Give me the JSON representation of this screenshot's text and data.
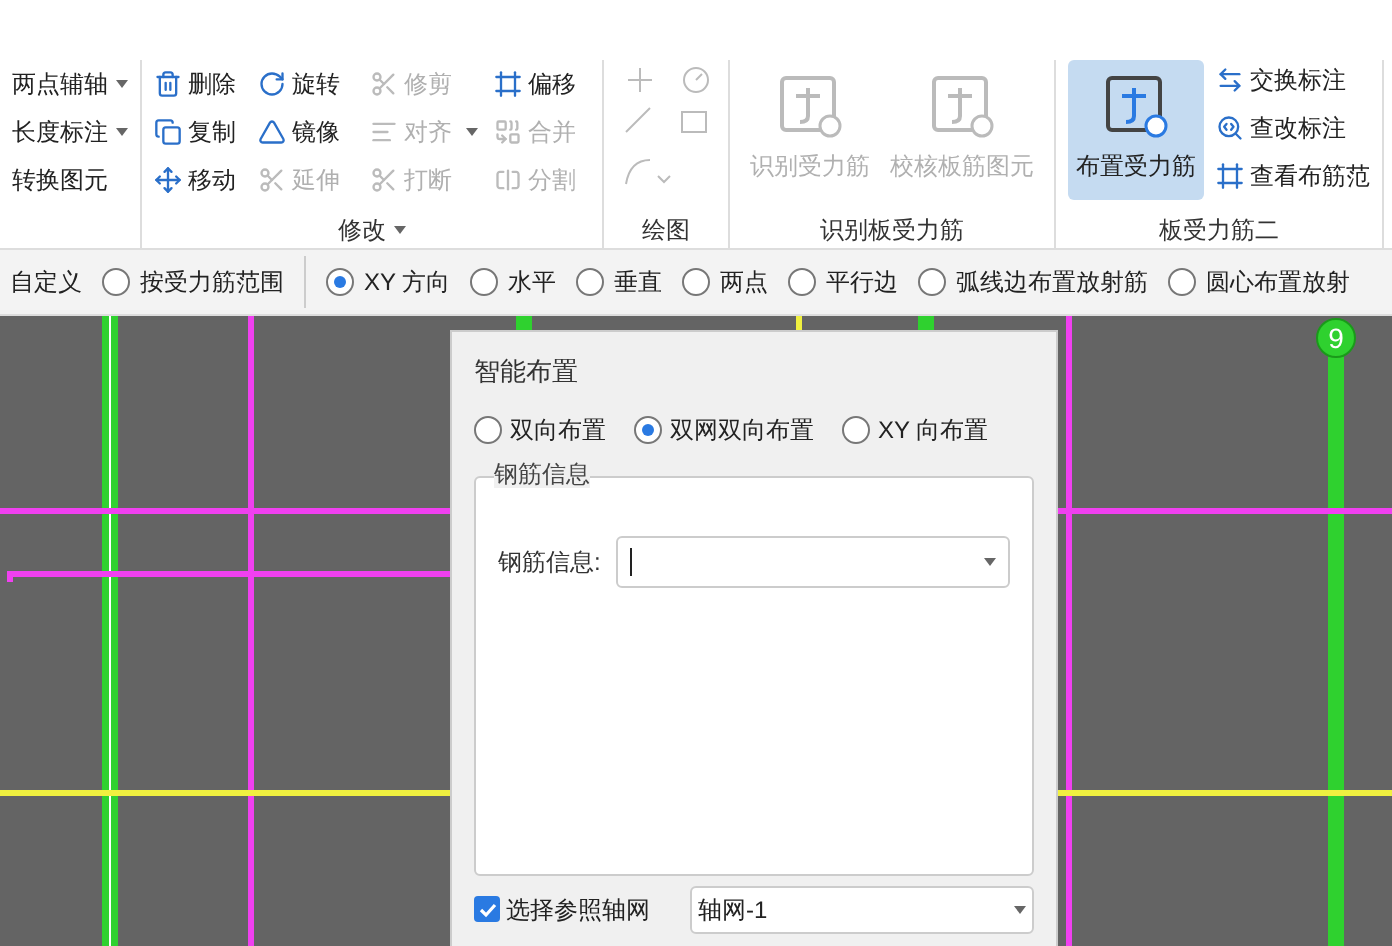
{
  "ribbon": {
    "groups": [
      {
        "kind": "list",
        "items": [
          {
            "label": "两点辅轴",
            "dropdown": true,
            "disabled": false
          },
          {
            "label": "长度标注",
            "dropdown": true,
            "disabled": false
          },
          {
            "label": "转换图元",
            "dropdown": false,
            "disabled": false
          }
        ]
      },
      {
        "kind": "grid",
        "label": "修改",
        "label_dropdown": true,
        "items": [
          {
            "label": "删除",
            "disabled": false,
            "dropdown": false
          },
          {
            "label": "旋转",
            "disabled": false,
            "dropdown": false
          },
          {
            "label": "修剪",
            "disabled": true,
            "dropdown": false
          },
          {
            "label": "偏移",
            "disabled": false,
            "dropdown": false
          },
          {
            "label": "复制",
            "disabled": false,
            "dropdown": false
          },
          {
            "label": "镜像",
            "disabled": false,
            "dropdown": false
          },
          {
            "label": "对齐",
            "disabled": true,
            "dropdown": true
          },
          {
            "label": "合并",
            "disabled": true,
            "dropdown": false
          },
          {
            "label": "移动",
            "disabled": false,
            "dropdown": false
          },
          {
            "label": "延伸",
            "disabled": true,
            "dropdown": false
          },
          {
            "label": "打断",
            "disabled": true,
            "dropdown": false
          },
          {
            "label": "分割",
            "disabled": true,
            "dropdown": false
          }
        ]
      },
      {
        "kind": "draw",
        "label": "绘图"
      },
      {
        "kind": "big",
        "label": "识别板受力筋",
        "items": [
          {
            "label": "识别受力筋",
            "disabled": true,
            "selected": false
          },
          {
            "label": "校核板筋图元",
            "disabled": true,
            "selected": false
          }
        ]
      },
      {
        "kind": "mixed",
        "label": "板受力筋二",
        "items": [
          {
            "label": "布置受力筋",
            "disabled": false,
            "selected": true
          }
        ],
        "small_items": [
          {
            "label": "交换标注"
          },
          {
            "label": "查改标注"
          },
          {
            "label": "查看布筋范"
          }
        ]
      }
    ]
  },
  "option_bar": {
    "prefix": "自定义",
    "options": [
      {
        "label": "按受力筋范围",
        "selected": false
      },
      {
        "label": "XY 方向",
        "selected": true
      },
      {
        "label": "水平",
        "selected": false
      },
      {
        "label": "垂直",
        "selected": false
      },
      {
        "label": "两点",
        "selected": false
      },
      {
        "label": "平行边",
        "selected": false
      },
      {
        "label": "弧线边布置放射筋",
        "selected": false
      },
      {
        "label": "圆心布置放射",
        "selected": false
      }
    ]
  },
  "canvas": {
    "axis_label": "9"
  },
  "dialog": {
    "title": "智能布置",
    "modes": [
      {
        "label": "双向布置",
        "selected": false
      },
      {
        "label": "双网双向布置",
        "selected": true
      },
      {
        "label": "XY 向布置",
        "selected": false
      }
    ],
    "group_title": "钢筋信息",
    "field_label": "钢筋信息:",
    "reference": {
      "label": "选择参照轴网",
      "checked": true,
      "value": "轴网-1"
    }
  }
}
